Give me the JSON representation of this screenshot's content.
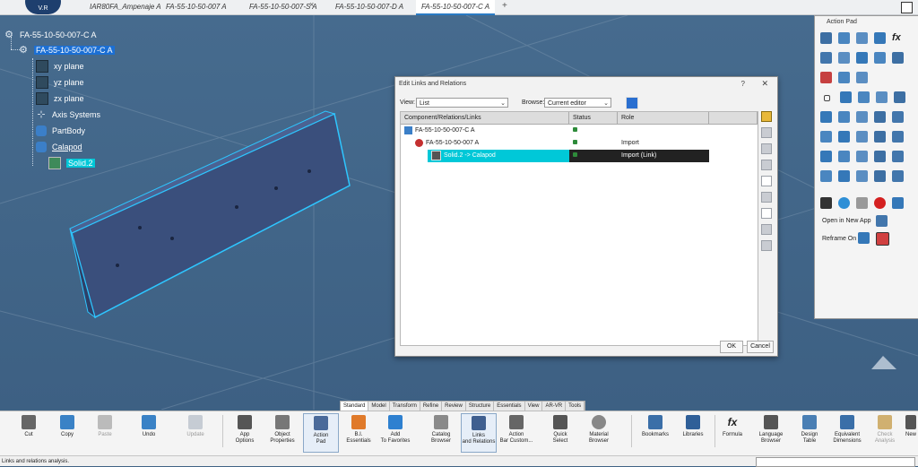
{
  "tabs": {
    "logo_text": "V.R",
    "items": [
      {
        "label": "IAR80FA_Ampenaje A"
      },
      {
        "label": "FA-55-10-50-007 A"
      },
      {
        "label": "FA-55-10-50-007-S A"
      },
      {
        "label": "FA-55-10-50-007-D A"
      },
      {
        "label": "FA-55-10-50-007-C A"
      }
    ],
    "close_glyph": "×",
    "add_glyph": "+"
  },
  "tree": {
    "root": "FA-55-10-50-007-C A",
    "part": "FA-55-10-50-007-C A",
    "xy": "xy plane",
    "yz": "yz plane",
    "zx": "zx plane",
    "axis": "Axis Systems",
    "partbody": "PartBody",
    "calapod": "Calapod",
    "solid": "Solid.2"
  },
  "dialog": {
    "title": "Edit Links and Relations",
    "help_glyph": "?",
    "close_glyph": "✕",
    "view_label": "View:",
    "view_value": "List",
    "browse_label": "Browse:",
    "browse_value": "Current editor",
    "columns": [
      "Component/Relations/Links",
      "Status",
      "Role"
    ],
    "rows": [
      {
        "name": "FA-55-10-50-007-C A",
        "role": ""
      },
      {
        "name": "FA-55-10-50-007 A",
        "role": "Import"
      },
      {
        "name": "Solid.2 -> Calapod",
        "role": "Import (Link)"
      }
    ],
    "ok": "OK",
    "cancel": "Cancel"
  },
  "action_pad": {
    "title": "Action Pad",
    "open_new_app": "Open in New App",
    "reframe_on": "Reframe On"
  },
  "ribbon_tabs": [
    "Standard",
    "Model",
    "Transform",
    "Refine",
    "Review",
    "Structure",
    "Essentials",
    "View",
    "AR-VR",
    "Tools"
  ],
  "toolbar": {
    "cut": "Cut",
    "copy": "Copy",
    "paste": "Paste",
    "undo": "Undo",
    "update": "Update",
    "app_options": [
      "App",
      "Options"
    ],
    "object_properties": [
      "Object",
      "Properties"
    ],
    "action_pad": [
      "Action",
      "Pad"
    ],
    "bi_essentials": [
      "B.I.",
      "Essentials"
    ],
    "add_favorites": [
      "Add",
      "To Favorites"
    ],
    "catalog_browser": [
      "Catalog",
      "Browser"
    ],
    "links_relations": [
      "Links",
      "and Relations"
    ],
    "action_bar": [
      "Action",
      "Bar Custom..."
    ],
    "quick_select": [
      "Quick",
      "Select"
    ],
    "material_browser": [
      "Material",
      "Browser"
    ],
    "bookmarks": "Bookmarks",
    "libraries": "Libraries",
    "formula": "Formula",
    "language_browser": [
      "Language",
      "Browser"
    ],
    "design_table": [
      "Design",
      "Table"
    ],
    "equivalent_dimensions": [
      "Equivalent",
      "Dimensions"
    ],
    "check_analysis": [
      "Check",
      "Analysis"
    ],
    "new": "New"
  },
  "status": "Links and relations analysis.",
  "colors": {
    "background": "#3f6385",
    "selection": "#00c8d8",
    "accent": "#1b6fd4"
  }
}
